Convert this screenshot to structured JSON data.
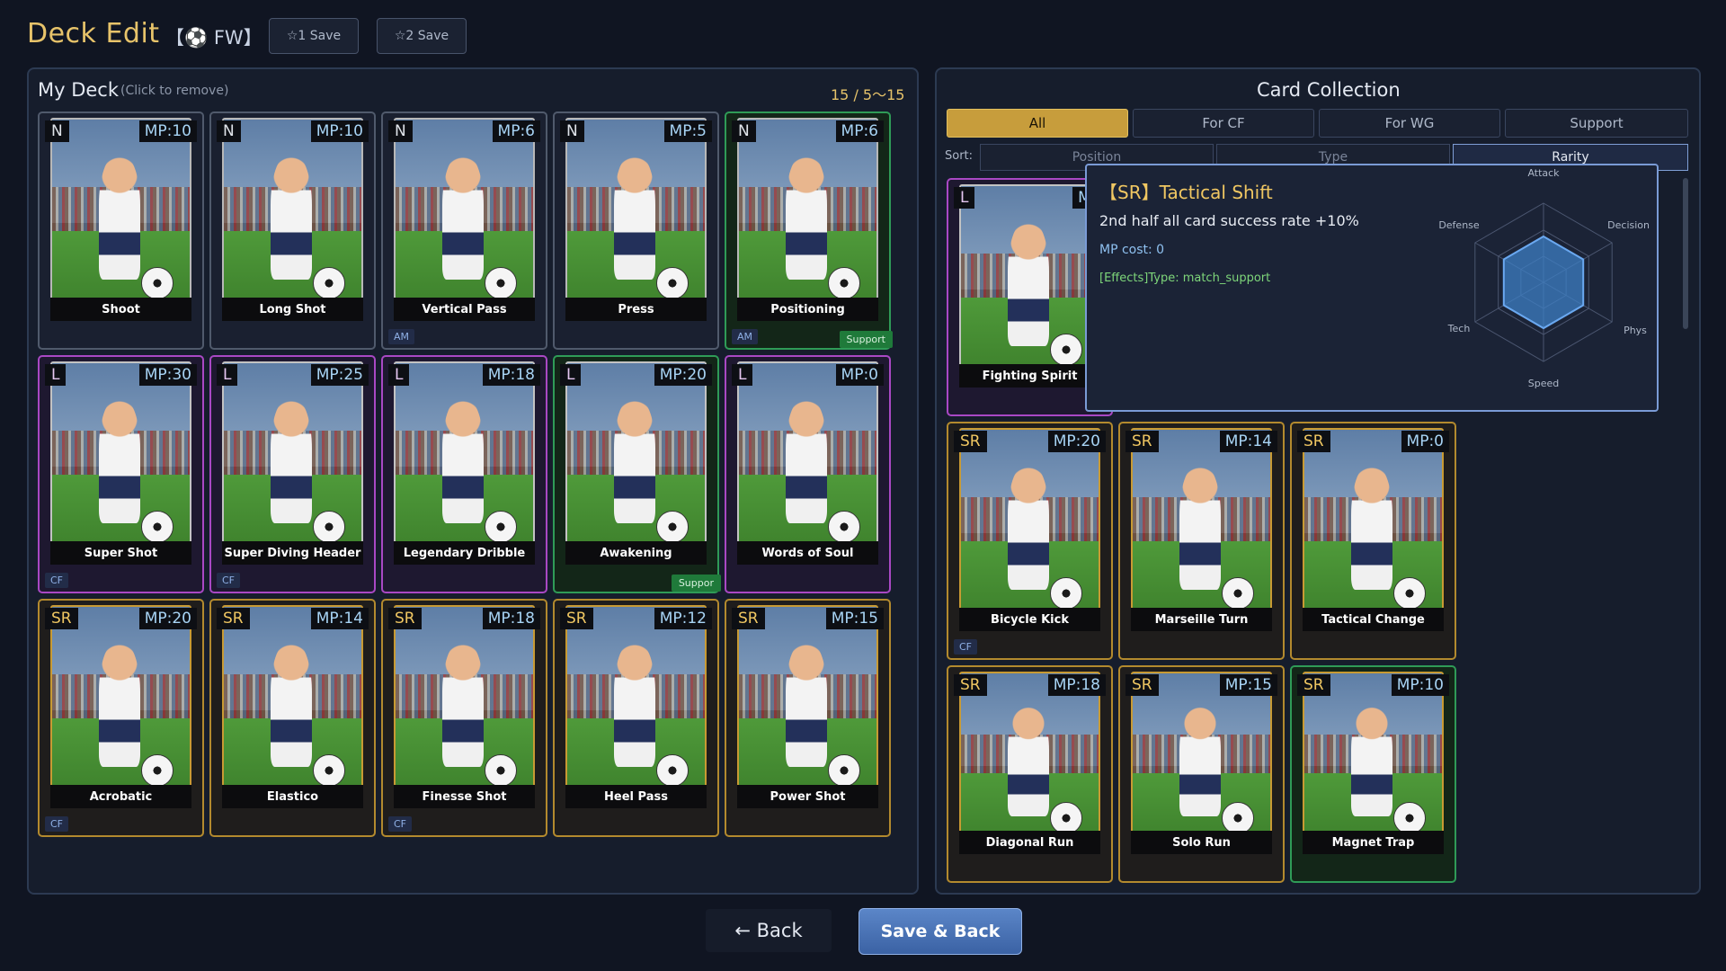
{
  "header": {
    "title": "Deck Edit",
    "position": "【⚽ FW】",
    "save_slots": [
      "☆1 Save",
      "☆2 Save"
    ]
  },
  "deck": {
    "title": "My Deck",
    "hint": "(Click to remove)",
    "count": "15 / 5～15",
    "cards": [
      {
        "name": "Shoot",
        "rarity": "N",
        "mp": "MP:10",
        "tag": "",
        "support": false,
        "support_label": ""
      },
      {
        "name": "Long Shot",
        "rarity": "N",
        "mp": "MP:10",
        "tag": "",
        "support": false,
        "support_label": ""
      },
      {
        "name": "Vertical Pass",
        "rarity": "N",
        "mp": "MP:6",
        "tag": "AM",
        "support": false,
        "support_label": ""
      },
      {
        "name": "Press",
        "rarity": "N",
        "mp": "MP:5",
        "tag": "",
        "support": false,
        "support_label": ""
      },
      {
        "name": "Positioning",
        "rarity": "N",
        "mp": "MP:6",
        "tag": "AM",
        "support": true,
        "support_label": "Support"
      },
      {
        "name": "Super Shot",
        "rarity": "L",
        "mp": "MP:30",
        "tag": "CF",
        "support": false,
        "support_label": ""
      },
      {
        "name": "Super Diving Header",
        "rarity": "L",
        "mp": "MP:25",
        "tag": "CF",
        "support": false,
        "support_label": ""
      },
      {
        "name": "Legendary Dribble",
        "rarity": "L",
        "mp": "MP:18",
        "tag": "",
        "support": false,
        "support_label": ""
      },
      {
        "name": "Awakening",
        "rarity": "L",
        "mp": "MP:20",
        "tag": "",
        "support": true,
        "support_label": "Suppor"
      },
      {
        "name": "Words of Soul",
        "rarity": "L",
        "mp": "MP:0",
        "tag": "",
        "support": false,
        "support_label": ""
      },
      {
        "name": "Acrobatic",
        "rarity": "SR",
        "mp": "MP:20",
        "tag": "CF",
        "support": false,
        "support_label": ""
      },
      {
        "name": "Elastico",
        "rarity": "SR",
        "mp": "MP:14",
        "tag": "",
        "support": false,
        "support_label": ""
      },
      {
        "name": "Finesse Shot",
        "rarity": "SR",
        "mp": "MP:18",
        "tag": "CF",
        "support": false,
        "support_label": ""
      },
      {
        "name": "Heel Pass",
        "rarity": "SR",
        "mp": "MP:12",
        "tag": "",
        "support": false,
        "support_label": ""
      },
      {
        "name": "Power Shot",
        "rarity": "SR",
        "mp": "MP:15",
        "tag": "",
        "support": false,
        "support_label": ""
      }
    ]
  },
  "collection": {
    "title": "Card Collection",
    "filter_tabs": [
      "All",
      "For CF",
      "For WG",
      "Support"
    ],
    "active_filter": "All",
    "sort_label": "Sort:",
    "sort_tabs": [
      "Position",
      "Type",
      "Rarity"
    ],
    "active_sort": "Rarity",
    "cards": [
      {
        "name": "Fighting Spirit",
        "rarity": "L",
        "mp": "MP",
        "tag": "",
        "support": false
      },
      {
        "name": "Bicycle Kick",
        "rarity": "SR",
        "mp": "MP:20",
        "tag": "CF",
        "support": false
      },
      {
        "name": "Marseille Turn",
        "rarity": "SR",
        "mp": "MP:14",
        "tag": "",
        "support": false
      },
      {
        "name": "Tactical Change",
        "rarity": "SR",
        "mp": "MP:0",
        "tag": "",
        "support": false
      },
      {
        "name": "Diagonal Run",
        "rarity": "SR",
        "mp": "MP:18",
        "tag": "",
        "support": false
      },
      {
        "name": "Solo Run",
        "rarity": "SR",
        "mp": "MP:15",
        "tag": "",
        "support": false
      },
      {
        "name": "Magnet Trap",
        "rarity": "SR",
        "mp": "MP:10",
        "tag": "",
        "support": true
      }
    ]
  },
  "tooltip": {
    "title": "【SR】Tactical Shift",
    "description": "2nd half all card success rate +10%",
    "mp_cost": "MP cost: 0",
    "effects": "[Effects]Type: match_support",
    "radar_labels": {
      "attack": "Attack",
      "decision": "Decision",
      "phys": "Phys",
      "speed": "Speed",
      "tech": "Tech",
      "defense": "Defense"
    },
    "radar_values": {
      "attack": 0.58,
      "decision": 0.58,
      "phys": 0.58,
      "speed": 0.58,
      "tech": 0.58,
      "defense": 0.58
    }
  },
  "footer": {
    "back_label": "← Back",
    "save_back_label": "Save & Back"
  }
}
